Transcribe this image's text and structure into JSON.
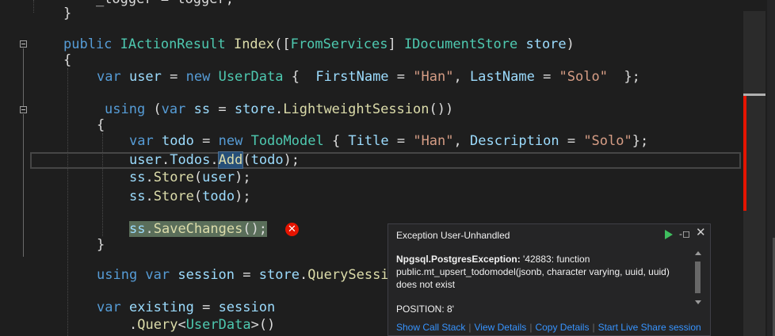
{
  "editor": {
    "lines": [
      [
        [
          "pl",
          "    _logger = logger;"
        ]
      ],
      [
        [
          "pl",
          "}"
        ]
      ],
      [
        [
          "kw",
          "public "
        ],
        [
          "ty",
          "IActionResult "
        ],
        [
          "fn",
          "Index"
        ],
        [
          "pl",
          "(["
        ],
        [
          "ty",
          "FromServices"
        ],
        [
          "pl",
          "] "
        ],
        [
          "ty",
          "IDocumentStore "
        ],
        [
          "id",
          "store"
        ],
        [
          "pl",
          ")"
        ]
      ],
      [
        [
          "pl",
          "{"
        ]
      ],
      [
        [
          "kw",
          "var "
        ],
        [
          "id",
          "user "
        ],
        [
          "pl",
          "= "
        ],
        [
          "kw",
          "new "
        ],
        [
          "ty",
          "UserData "
        ],
        [
          "pl",
          "{  "
        ],
        [
          "id",
          "FirstName "
        ],
        [
          "pl",
          "= "
        ],
        [
          "st",
          "\"Han\""
        ],
        [
          "pl",
          ", "
        ],
        [
          "id",
          "LastName "
        ],
        [
          "pl",
          "= "
        ],
        [
          "st",
          "\"Solo\""
        ],
        [
          "pl",
          "  };"
        ]
      ],
      [
        [
          "kw",
          "using "
        ],
        [
          "pl",
          "("
        ],
        [
          "kw",
          "var "
        ],
        [
          "id",
          "ss "
        ],
        [
          "pl",
          "= "
        ],
        [
          "id",
          "store"
        ],
        [
          "pl",
          "."
        ],
        [
          "fn",
          "LightweightSession"
        ],
        [
          "pl",
          "())"
        ]
      ],
      [
        [
          "pl",
          "{"
        ]
      ],
      [
        [
          "kw",
          "var "
        ],
        [
          "id",
          "todo "
        ],
        [
          "pl",
          "= "
        ],
        [
          "kw",
          "new "
        ],
        [
          "ty",
          "TodoModel "
        ],
        [
          "pl",
          "{ "
        ],
        [
          "id",
          "Title "
        ],
        [
          "pl",
          "= "
        ],
        [
          "st",
          "\"Han\""
        ],
        [
          "pl",
          ", "
        ],
        [
          "id",
          "Description "
        ],
        [
          "pl",
          "= "
        ],
        [
          "st",
          "\"Solo\""
        ],
        [
          "pl",
          "};"
        ]
      ],
      [
        [
          "id",
          "user"
        ],
        [
          "pl",
          "."
        ],
        [
          "id",
          "Todos"
        ],
        [
          "pl",
          "."
        ],
        [
          "fn",
          "Add"
        ],
        [
          "pl",
          "("
        ],
        [
          "id",
          "todo"
        ],
        [
          "pl",
          ");"
        ]
      ],
      [
        [
          "id",
          "ss"
        ],
        [
          "pl",
          "."
        ],
        [
          "fn",
          "Store"
        ],
        [
          "pl",
          "("
        ],
        [
          "id",
          "user"
        ],
        [
          "pl",
          ");"
        ]
      ],
      [
        [
          "id",
          "ss"
        ],
        [
          "pl",
          "."
        ],
        [
          "fn",
          "Store"
        ],
        [
          "pl",
          "("
        ],
        [
          "id",
          "todo"
        ],
        [
          "pl",
          ");"
        ]
      ],
      [
        [
          "id",
          "ss"
        ],
        [
          "pl",
          "."
        ],
        [
          "fn",
          "SaveChanges"
        ],
        [
          "pl",
          "();"
        ]
      ],
      [
        [
          "pl",
          "}"
        ]
      ],
      [
        [
          "kw",
          "using "
        ],
        [
          "kw",
          "var "
        ],
        [
          "id",
          "session "
        ],
        [
          "pl",
          "= "
        ],
        [
          "id",
          "store"
        ],
        [
          "pl",
          "."
        ],
        [
          "fn",
          "QuerySessi"
        ]
      ],
      [
        [
          "kw",
          "var "
        ],
        [
          "id",
          "existing "
        ],
        [
          "pl",
          "= "
        ],
        [
          "id",
          "session"
        ]
      ],
      [
        [
          "pl",
          "."
        ],
        [
          "fn",
          "Query"
        ],
        [
          "pl",
          "<"
        ],
        [
          "ty",
          "UserData"
        ],
        [
          "pl",
          ">()"
        ]
      ]
    ]
  },
  "error_glyph": "✕",
  "popup": {
    "title": "Exception User-Unhandled",
    "pin_icon": "-◻",
    "close_icon": "✕",
    "exception_type": "Npgsql.PostgresException:",
    "message": " '42883: function public.mt_upsert_todomodel(jsonb, character varying, uuid, uuid) does not exist",
    "position": "POSITION: 8'",
    "links": [
      "Show Call Stack",
      "View Details",
      "Copy Details",
      "Start Live Share session"
    ]
  }
}
